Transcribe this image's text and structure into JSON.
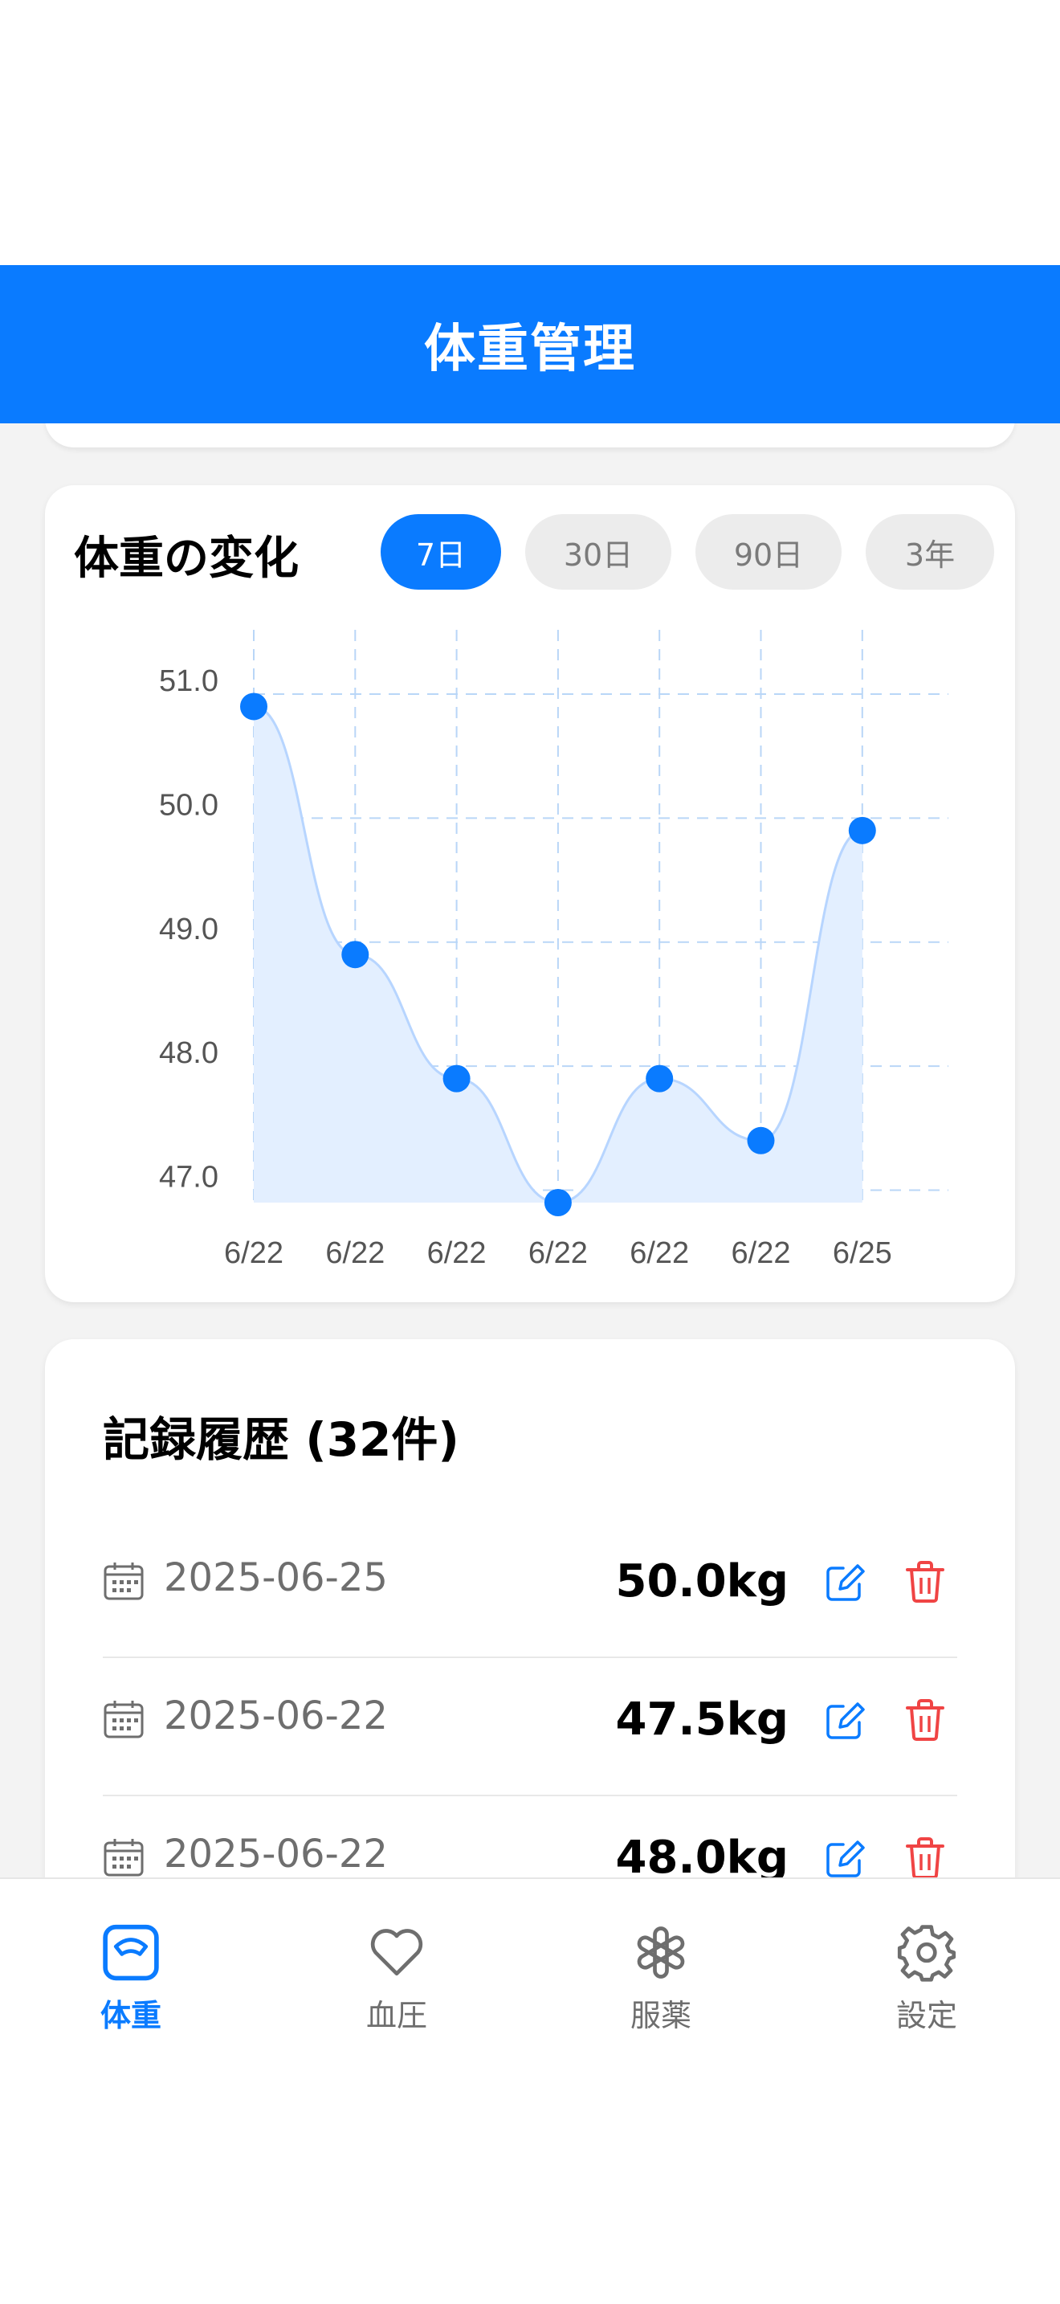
{
  "header": {
    "title": "体重管理"
  },
  "chart_card": {
    "title": "体重の変化",
    "ranges": [
      {
        "label": "7日",
        "active": true
      },
      {
        "label": "30日",
        "active": false
      },
      {
        "label": "90日",
        "active": false
      },
      {
        "label": "3年",
        "active": false
      }
    ]
  },
  "chart_data": {
    "type": "area",
    "categories": [
      "6/22",
      "6/22",
      "6/22",
      "6/22",
      "6/22",
      "6/22",
      "6/25"
    ],
    "values": [
      50.9,
      48.9,
      47.9,
      46.9,
      47.9,
      47.4,
      49.9
    ],
    "ylim": [
      46.9,
      51.0
    ],
    "y_ticks": [
      "51.0",
      "50.0",
      "49.0",
      "48.0",
      "47.0"
    ],
    "grid": true,
    "line_color": "#0a7bff",
    "fill_color": "#e3efff"
  },
  "history": {
    "title": "記録履歴 (32件)",
    "records": [
      {
        "date": "2025-06-25",
        "weight": "50.0kg"
      },
      {
        "date": "2025-06-22",
        "weight": "47.5kg"
      },
      {
        "date": "2025-06-22",
        "weight": "48.0kg"
      }
    ]
  },
  "tab_bar": {
    "items": [
      {
        "label": "体重",
        "icon": "scale-icon",
        "active": true
      },
      {
        "label": "血圧",
        "icon": "heart-icon",
        "active": false
      },
      {
        "label": "服薬",
        "icon": "medication-icon",
        "active": false
      },
      {
        "label": "設定",
        "icon": "gear-icon",
        "active": false
      }
    ]
  },
  "colors": {
    "primary": "#0a7bff",
    "delete": "#f04444",
    "inactive": "#6e6e6e"
  }
}
